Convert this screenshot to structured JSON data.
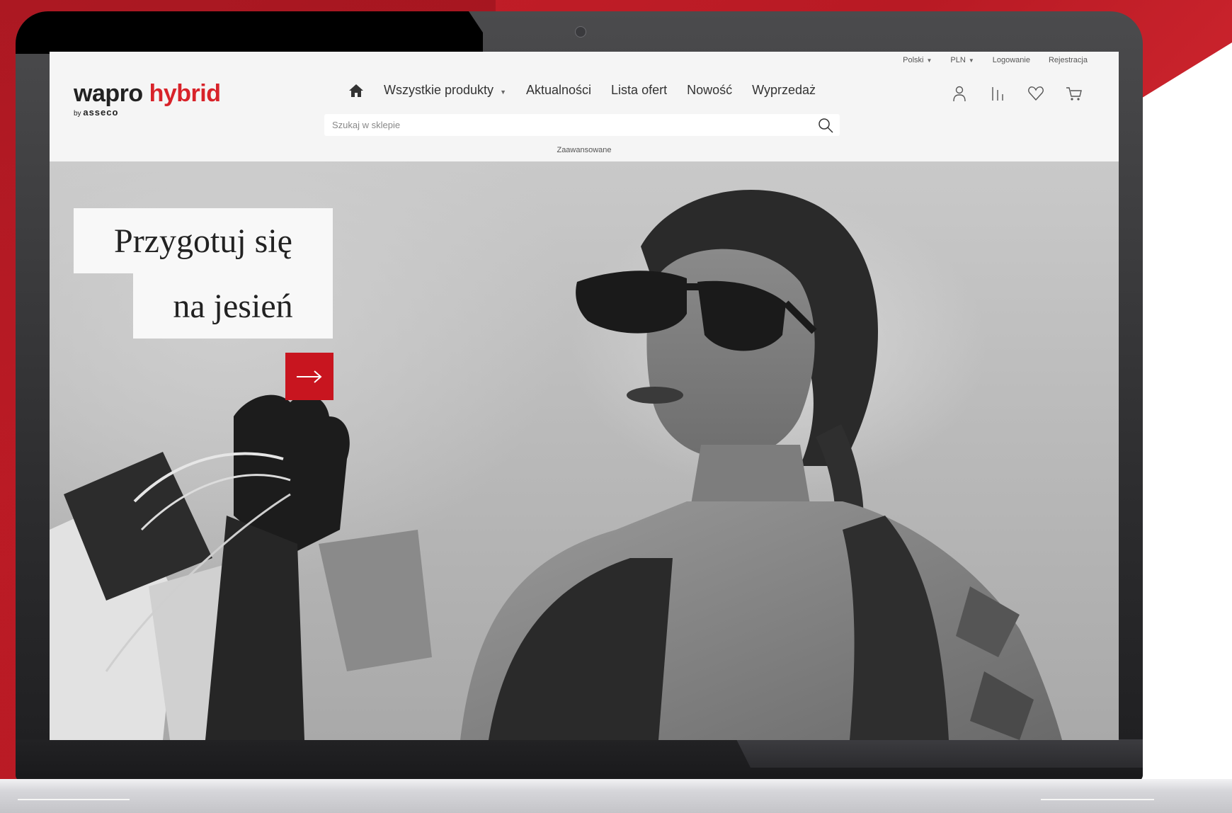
{
  "topbar": {
    "language": "Polski",
    "currency": "PLN",
    "login": "Logowanie",
    "register": "Rejestracja"
  },
  "logo": {
    "word1": "wapro",
    "word2": "hybrid",
    "by": "by",
    "brand": "asseco"
  },
  "nav": {
    "all_products": "Wszystkie produkty",
    "news": "Aktualności",
    "offers": "Lista ofert",
    "new": "Nowość",
    "sale": "Wyprzedaż"
  },
  "search": {
    "placeholder": "Szukaj w sklepie",
    "advanced": "Zaawansowane"
  },
  "hero": {
    "line1": "Przygotuj się",
    "line2": "na jesień"
  },
  "icons": [
    "home-icon",
    "user-icon",
    "compare-icon",
    "heart-icon",
    "cart-icon",
    "search-icon",
    "arrow-right-icon"
  ],
  "colors": {
    "brand_red": "#d8232a",
    "cta_red": "#c8151f",
    "header_bg": "#f5f5f5"
  }
}
